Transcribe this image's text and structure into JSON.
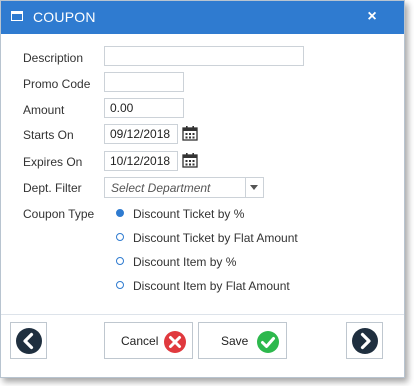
{
  "dialog": {
    "title": "COUPON",
    "close_glyph": "×",
    "title_icon": "window-icon"
  },
  "form": {
    "description_label": "Description",
    "description_value": "",
    "promo_code_label": "Promo Code",
    "promo_code_value": "",
    "amount_label": "Amount",
    "amount_value": "0.00",
    "starts_on_label": "Starts On",
    "starts_on_value": "09/12/2018",
    "expires_on_label": "Expires On",
    "expires_on_value": "10/12/2018",
    "dept_filter_label": "Dept. Filter",
    "dept_filter_placeholder": "Select Department",
    "coupon_type_label": "Coupon Type",
    "coupon_types": [
      {
        "label": "Discount Ticket by %",
        "checked": true
      },
      {
        "label": "Discount Ticket by Flat Amount",
        "checked": false
      },
      {
        "label": "Discount Item by %",
        "checked": false
      },
      {
        "label": "Discount Item by Flat Amount",
        "checked": false
      }
    ]
  },
  "footer": {
    "cancel_label": "Cancel",
    "save_label": "Save"
  },
  "colors": {
    "accent": "#2f7bd0",
    "cancel_red": "#e0393e",
    "save_green": "#2db84d",
    "nav_dark": "#1f2f3f"
  }
}
